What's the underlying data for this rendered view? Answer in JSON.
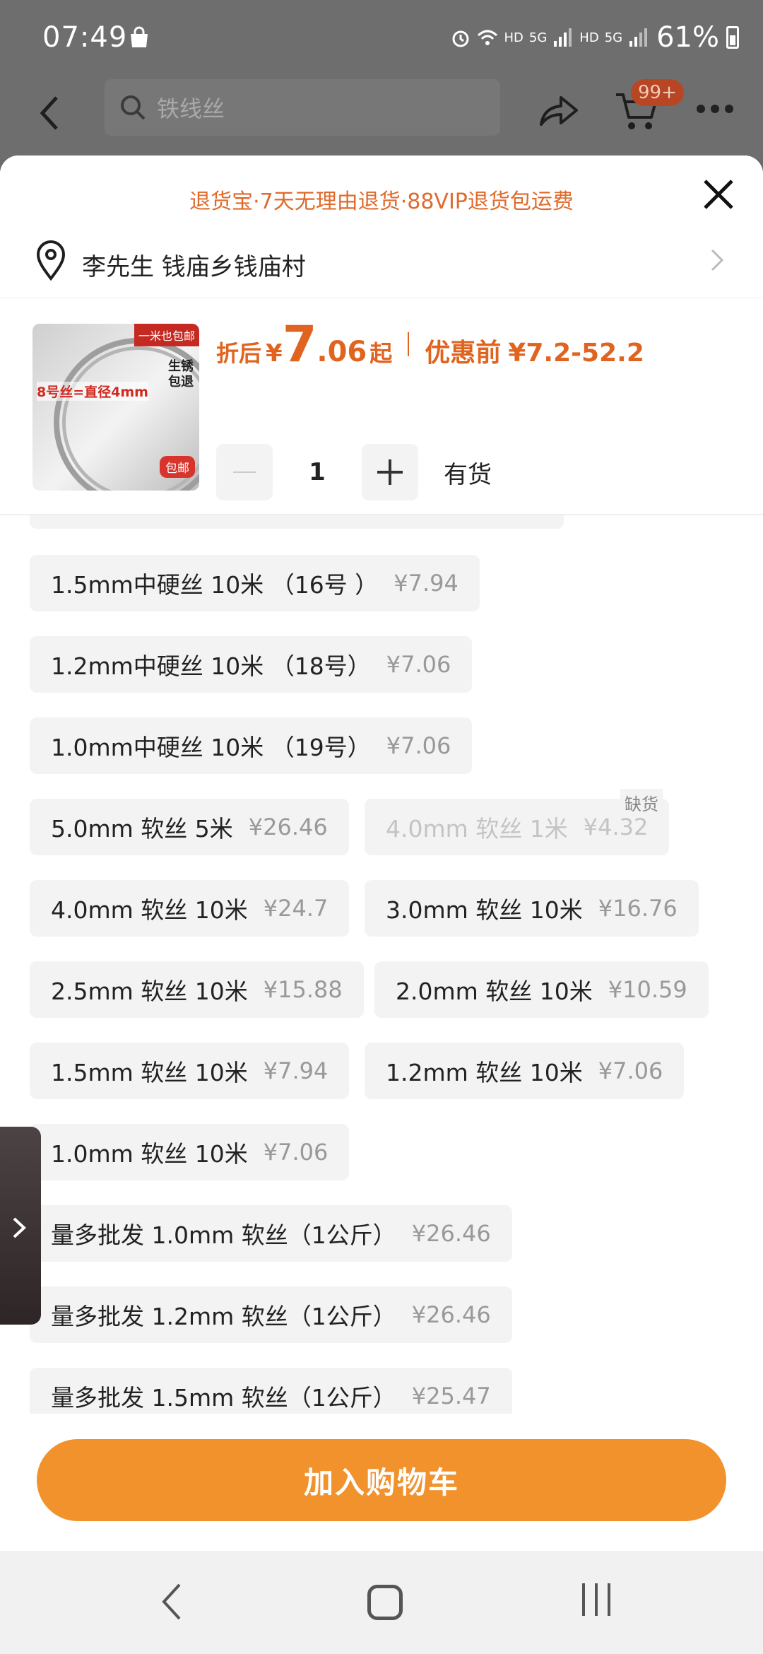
{
  "status_bar": {
    "time": "07:49",
    "hd1": "HD",
    "net1": "5G",
    "hd2": "HD",
    "net2": "5G",
    "battery": "61%"
  },
  "header": {
    "search_text": "铁线丝",
    "cart_badge": "99+"
  },
  "sheet": {
    "return_banner": "退货宝·7天无理由退货·88VIP退货包运费",
    "address": "李先生 钱庙乡钱庙村",
    "product": {
      "image_tags": {
        "top": "一米也包邮",
        "spec": "8号丝=直径4mm",
        "side": "生锈包退",
        "badge": "包邮"
      },
      "discount_label": "折后",
      "currency": "¥",
      "price_int": "7",
      "price_dec": ".06",
      "price_suffix": "起",
      "original_label": "优惠前",
      "original_range": "¥7.2-52.2"
    },
    "quantity": {
      "value": "1",
      "stock": "有货"
    },
    "options": [
      {
        "name": "1.5mm中硬丝 10米 （16号 ）",
        "price": "¥7.94",
        "available": true
      },
      {
        "name": "1.2mm中硬丝 10米 （18号）",
        "price": "¥7.06",
        "available": true
      },
      {
        "name": "1.0mm中硬丝 10米 （19号）",
        "price": "¥7.06",
        "available": true
      },
      {
        "name": "5.0mm 软丝 5米",
        "price": "¥26.46",
        "available": true
      },
      {
        "name": "4.0mm 软丝 1米",
        "price": "¥4.32",
        "available": false,
        "badge": "缺货"
      },
      {
        "name": "4.0mm 软丝 10米",
        "price": "¥24.7",
        "available": true
      },
      {
        "name": "3.0mm 软丝 10米",
        "price": "¥16.76",
        "available": true
      },
      {
        "name": "2.5mm 软丝 10米",
        "price": "¥15.88",
        "available": true
      },
      {
        "name": "2.0mm 软丝 10米",
        "price": "¥10.59",
        "available": true
      },
      {
        "name": "1.5mm 软丝 10米",
        "price": "¥7.94",
        "available": true
      },
      {
        "name": "1.2mm 软丝 10米",
        "price": "¥7.06",
        "available": true
      },
      {
        "name": "1.0mm 软丝 10米",
        "price": "¥7.06",
        "available": true
      },
      {
        "name": "量多批发 1.0mm 软丝（1公斤）",
        "price": "¥26.46",
        "available": true
      },
      {
        "name": "量多批发 1.2mm 软丝（1公斤）",
        "price": "¥26.46",
        "available": true
      },
      {
        "name": "量多批发 1.5mm 软丝（1公斤）",
        "price": "¥25.47",
        "available": true
      }
    ],
    "add_to_cart": "加入购物车"
  }
}
